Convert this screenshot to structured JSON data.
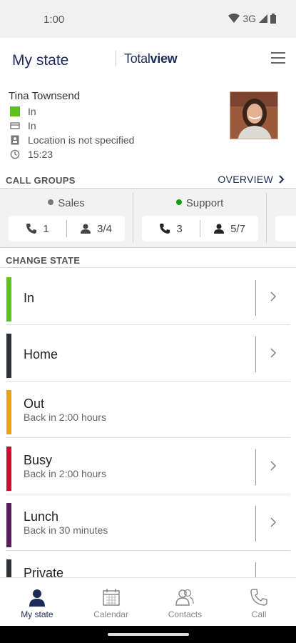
{
  "status_bar": {
    "time": "1:00",
    "network": "3G"
  },
  "app_bar": {
    "title": "My state",
    "logo_regular": "Total",
    "logo_bold": "view"
  },
  "profile": {
    "name": "Tina Townsend",
    "state": "In",
    "state_color": "#5cc21c",
    "second_state": "In",
    "location": "Location is not specified",
    "time": "15:23"
  },
  "call_groups": {
    "heading": "CALL GROUPS",
    "overview_label": "OVERVIEW",
    "groups": [
      {
        "name": "Sales",
        "dot_color": "#777777",
        "calls": "1",
        "agents": "3/4"
      },
      {
        "name": "Support",
        "dot_color": "#1a9a1a",
        "calls": "3",
        "agents": "5/7"
      }
    ]
  },
  "change_state": {
    "heading": "CHANGE STATE",
    "states": [
      {
        "label": "In",
        "sub": "",
        "color": "#5cc21c",
        "has_chevron": true
      },
      {
        "label": "Home",
        "sub": "",
        "color": "#2d3135",
        "has_chevron": true
      },
      {
        "label": "Out",
        "sub": "Back in 2:00 hours",
        "color": "#e6a21a",
        "has_chevron": false
      },
      {
        "label": "Busy",
        "sub": "Back in 2:00 hours",
        "color": "#c8102e",
        "has_chevron": true
      },
      {
        "label": "Lunch",
        "sub": "Back in 30 minutes",
        "color": "#5a1a5e",
        "has_chevron": true
      },
      {
        "label": "Private",
        "sub": "",
        "color": "#2d3135",
        "has_chevron": true
      }
    ]
  },
  "bottom_nav": {
    "items": [
      {
        "label": "My state",
        "icon": "person-icon",
        "active": true
      },
      {
        "label": "Calendar",
        "icon": "calendar-icon",
        "active": false
      },
      {
        "label": "Contacts",
        "icon": "contacts-icon",
        "active": false
      },
      {
        "label": "Call",
        "icon": "phone-icon",
        "active": false
      }
    ]
  }
}
